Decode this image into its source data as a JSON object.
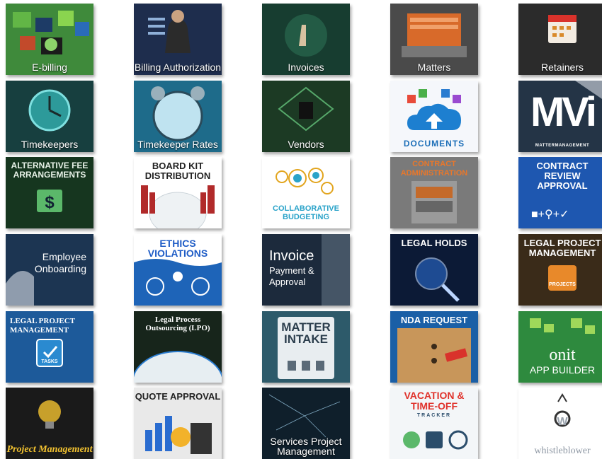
{
  "tiles": [
    {
      "id": "e-billing",
      "caption": "E-billing",
      "style": "bottom",
      "bg": "#2f6b32"
    },
    {
      "id": "billing-authorization",
      "caption": "Billing\nAuthorization",
      "style": "bottom",
      "bg": "#2a3f66"
    },
    {
      "id": "invoices",
      "caption": "Invoices",
      "style": "bottom",
      "bg": "#1e4a3a"
    },
    {
      "id": "matters",
      "caption": "Matters",
      "style": "bottom",
      "bg": "#3a3a3a"
    },
    {
      "id": "retainers",
      "caption": "Retainers",
      "style": "bottom",
      "bg": "#262626"
    },
    {
      "id": "timekeepers",
      "caption": "Timekeepers",
      "style": "bottom",
      "bg": "#1b4a4a"
    },
    {
      "id": "timekeeper-rates",
      "caption": "Timekeeper\nRates",
      "style": "bottom",
      "bg": "#1b5c7a"
    },
    {
      "id": "vendors",
      "caption": "Vendors",
      "style": "bottom",
      "bg": "#1f3a26"
    },
    {
      "id": "documents",
      "caption": "DOCUMENTS",
      "style": "bottom-blue",
      "bg": "#f5f7fb"
    },
    {
      "id": "mattermanagement",
      "caption": "MATTERMANAGEMENT",
      "style": "mvi",
      "bg": "#1f2d3d",
      "logo": "MVi"
    },
    {
      "id": "alternative-fee-arrangements",
      "caption": "ALTERNATIVE FEE\nARRANGEMENTS",
      "style": "top-green",
      "bg": "#13331d"
    },
    {
      "id": "board-kit-distribution",
      "caption": "BOARD KIT\nDISTRIBUTION",
      "style": "top-dark",
      "bg": "#ffffff"
    },
    {
      "id": "collaborative-budgeting",
      "caption": "COLLABORATIVE\nBUDGETING",
      "style": "collab",
      "bg": "#ffffff"
    },
    {
      "id": "contract-administration",
      "caption": "CONTRACT\nADMINISTRATION",
      "style": "top-orange",
      "bg": "#8b8b8b"
    },
    {
      "id": "contract-review-approval",
      "caption": "CONTRACT\nREVIEW\nAPPROVAL",
      "style": "top-white",
      "bg": "#1b4fa0"
    },
    {
      "id": "employee-onboarding",
      "caption": "Employee\nOnboarding",
      "style": "center-right",
      "bg": "#1d3550"
    },
    {
      "id": "ethics-violations",
      "caption": "ETHICS\nVIOLATIONS",
      "style": "top-navy",
      "bg": "#ffffff"
    },
    {
      "id": "invoice-payment-approval",
      "caption": "Invoice",
      "sub": "Payment\n& Approval",
      "style": "invoice",
      "bg": "#1e2c3e"
    },
    {
      "id": "legal-holds",
      "caption": "LEGAL HOLDS",
      "style": "top-white",
      "bg": "#0d1a36"
    },
    {
      "id": "legal-project-management-1",
      "caption": "LEGAL PROJECT\nMANAGEMENT",
      "style": "top-white",
      "bg": "#3b2c1a",
      "badge": "PROJECTS"
    },
    {
      "id": "legal-project-management-2",
      "caption": "LEGAL PROJECT\nMANAGEMENT",
      "style": "top-white-left",
      "bg": "#1a4f8a",
      "badge": "TASKS"
    },
    {
      "id": "legal-process-outsourcing",
      "caption": "Legal Process\nOutsourcing (LPO)",
      "style": "top-serif",
      "bg": "#1a2a1f"
    },
    {
      "id": "matter-intake",
      "caption": "MATTER\nINTAKE",
      "style": "matter-intake",
      "bg": "#2f5a6b"
    },
    {
      "id": "nda-request",
      "caption": "NDA REQUEST",
      "style": "top-white",
      "bg": "#1a5fa6"
    },
    {
      "id": "onit-app-builder",
      "caption": "onit",
      "sub": "APP BUILDER",
      "style": "onit",
      "bg": "#2e8a3e"
    },
    {
      "id": "project-management",
      "caption": "Project\nManagement",
      "style": "pm",
      "bg": "#1b1b1b"
    },
    {
      "id": "quote-approval",
      "caption": "QUOTE APPROVAL",
      "style": "top-dark",
      "bg": "#e9e9e9"
    },
    {
      "id": "services-project-management",
      "caption": "Services Project\nManagement",
      "style": "bottom",
      "bg": "#11222e"
    },
    {
      "id": "vacation-time-off-tracker",
      "caption": "VACATION &\nTIME-OFF",
      "sub": "TRACKER",
      "style": "vacation",
      "bg": "#f3f6f8"
    },
    {
      "id": "whistleblower",
      "caption": "whistleblower",
      "style": "whistle",
      "bg": "#ffffff",
      "logo": "W"
    }
  ]
}
